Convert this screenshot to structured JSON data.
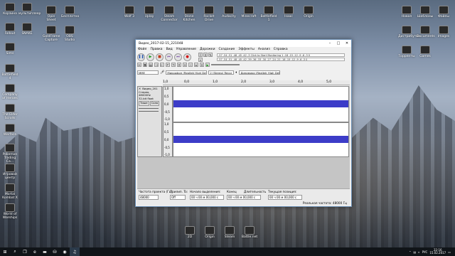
{
  "desktop": {
    "left_icons": [
      {
        "label": "Корзина",
        "icon": "recycle-bin-icon"
      },
      {
        "label": "мультиплеер",
        "icon": "game-icon"
      },
      {
        "label": "Fallout",
        "icon": "game-icon"
      },
      {
        "label": "SNAKE",
        "icon": "game-icon"
      },
      {
        "label": "Sims",
        "icon": "game-icon"
      },
      {
        "label": "Battlefield 4",
        "icon": "game-icon"
      },
      {
        "label": "Company of Heroes",
        "icon": "game-icon"
      },
      {
        "label": "The Elder Scrolls",
        "icon": "game-icon"
      },
      {
        "label": "Warface",
        "icon": "game-icon"
      },
      {
        "label": "Pokemon Trading Ca...",
        "icon": "game-icon"
      },
      {
        "label": "Игровой центр",
        "icon": "game-icon"
      },
      {
        "label": "Mortal Kombat X",
        "icon": "game-icon"
      },
      {
        "label": "World of Warships",
        "icon": "game-icon"
      }
    ],
    "top_icons": [
      {
        "label": "Opie Sheet",
        "icon": "app-icon"
      },
      {
        "label": "Бесплатно",
        "icon": "app-icon"
      },
      {
        "label": "GoldFrame Capture",
        "icon": "app-icon"
      },
      {
        "label": "OBS Studio",
        "icon": "app-icon"
      },
      {
        "label": "Wolf 3",
        "icon": "app-icon"
      },
      {
        "label": "Uplay",
        "icon": "app-icon"
      },
      {
        "label": "Steam Connector",
        "icon": "app-icon"
      },
      {
        "label": "Stone Kitchen",
        "icon": "app-icon"
      },
      {
        "label": "Rocket Drive",
        "icon": "app-icon"
      },
      {
        "label": "Audacity",
        "icon": "app-icon"
      },
      {
        "label": "Minecraft",
        "icon": "app-icon"
      },
      {
        "label": "Battlefield 1",
        "icon": "app-icon"
      },
      {
        "label": "Isaac",
        "icon": "app-icon"
      },
      {
        "label": "Origin",
        "icon": "app-icon"
      }
    ],
    "right_icons": [
      {
        "label": "Новая",
        "icon": "folder-icon"
      },
      {
        "label": "Шаблоны",
        "icon": "folder-icon"
      },
      {
        "label": "Файлы",
        "icon": "folder-icon"
      },
      {
        "label": "Дистрибутив",
        "icon": "folder-icon"
      },
      {
        "label": "Documents",
        "icon": "folder-icon"
      },
      {
        "label": "Images",
        "icon": "folder-icon"
      },
      {
        "label": "Торренты",
        "icon": "folder-icon"
      },
      {
        "label": "Games",
        "icon": "folder-icon"
      }
    ],
    "bottom_icons": [
      {
        "label": "2D",
        "icon": "app-icon"
      },
      {
        "label": "Origin",
        "icon": "origin-icon"
      },
      {
        "label": "Steam",
        "icon": "steam-icon"
      },
      {
        "label": "Battle.net",
        "icon": "battlenet-icon"
      }
    ]
  },
  "window": {
    "title": "Видео_2017-02-15_221048",
    "menu": [
      "Файл",
      "Правка",
      "Вид",
      "Управление",
      "Дорожки",
      "Создание",
      "Эффекты",
      "Анализ",
      "Справка"
    ],
    "meter_text": "-57 -54 -51 -48 -45 -42 -3 Click to Start Monitoring 1 -18 -15 -12 -9 -6 -3 0",
    "meter_text2": "-57 -54 -51 -48 -45 -42 -39 -36 -33 -30 -27 -24 -21 -18 -15 -12 -9 -6 -3 0",
    "host": "MME",
    "mic": "Микрофон (Realtek High Defi",
    "channels": "2 (Stereo) Recor",
    "speaker": "Динамики (Realtek High Defi",
    "ruler": [
      "1,0",
      "0,0",
      "1,0",
      "2,0",
      "3,0",
      "4,0",
      "5,0"
    ],
    "track": {
      "name": "Видео_201",
      "info1": "Стерео, 48000Hz",
      "info2": "32-bit float",
      "mute": "Тише",
      "solo": "Соло"
    },
    "scale": [
      "1,0",
      "0,5",
      "0,0",
      "-0,5",
      "-1,0",
      "1,0",
      "0,5",
      "0,0",
      "-0,5",
      "-1,0"
    ],
    "bottom": {
      "rate_label": "Частота проекта (Гц):",
      "rate_value": "48000",
      "snap_label": "Прилип. To:",
      "snap_value": "Off",
      "start_label": "Начало выделения:",
      "end_label": "Конец",
      "length_label": "Длительность",
      "start_value": "00 ч 00 м 00,000 с",
      "end_value": "00 ч 00 м 00,000 с",
      "pos_label": "Текущая позиция:",
      "pos_value": "00 ч 00 м 00,000 с",
      "status": "Реальная частота: 48000 Гц"
    }
  },
  "taskbar": {
    "start": "⊞",
    "tray_lang": "РУС",
    "time": "22:16",
    "date": "15.02.2017"
  }
}
